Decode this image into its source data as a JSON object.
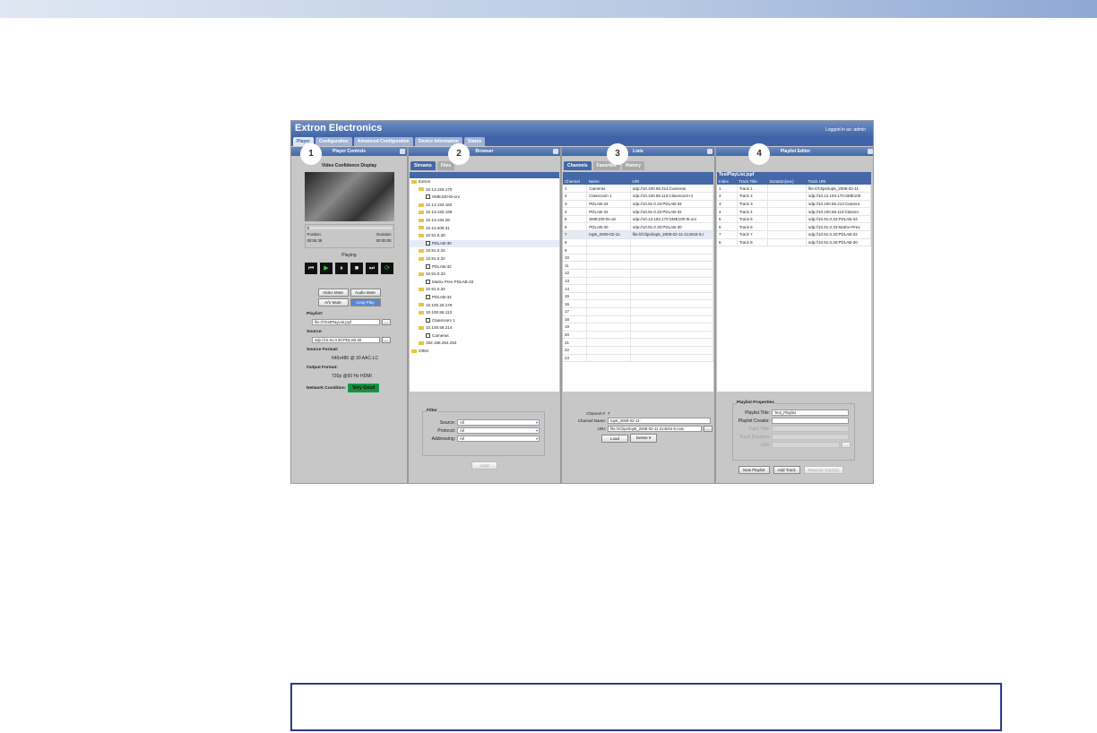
{
  "app": {
    "title": "Extron Electronics",
    "login": "Logged in as: admin"
  },
  "tabs": [
    "Player",
    "Configuration",
    "Advanced Configuration",
    "Device Information",
    "Status"
  ],
  "callouts": [
    "1",
    "2",
    "3",
    "4"
  ],
  "player": {
    "title": "Player Controls",
    "video_title": "Video Confidence Display",
    "position_label": "Position",
    "duration_label": "Duration",
    "position": "00:06:39",
    "duration": "00:00:08",
    "state": "Playing",
    "progress": 0.03,
    "buttons": [
      "Video Mute",
      "Audio Mute",
      "A/V Mute",
      "Loop Play"
    ],
    "playlist_label": "Playlist:",
    "playlist_value": "file:///TestPlayList.jspf",
    "source_label": "Source:",
    "source_value": "sdp://10.91.0.30:PDLAB-30",
    "browse": "...",
    "source_format_label": "Source Format:",
    "source_format": "640x480 @ 30 AAC-LC",
    "output_format_label": "Output Format:",
    "output_format": "720p @60 Hz HDMI",
    "network_label": "Network Condition:",
    "network_value": "Very Good",
    "network_color": "#1f8a3c"
  },
  "browser": {
    "title": "Browser",
    "tabs": [
      "Streams",
      "Files"
    ],
    "tree": [
      {
        "t": "Extron",
        "k": "f",
        "d": 0
      },
      {
        "t": "10.13.193.170",
        "k": "f",
        "d": 1
      },
      {
        "t": "SME100-t5-uni",
        "k": "s",
        "d": 2
      },
      {
        "t": "10.13.193.182",
        "k": "f",
        "d": 1
      },
      {
        "t": "10.13.193.198",
        "k": "f",
        "d": 1
      },
      {
        "t": "10.13.194.28",
        "k": "f",
        "d": 1
      },
      {
        "t": "10.13.209.31",
        "k": "f",
        "d": 1
      },
      {
        "t": "10.91.0.30",
        "k": "f",
        "d": 1
      },
      {
        "t": "PDLAB-30",
        "k": "s",
        "d": 2,
        "sel": true
      },
      {
        "t": "10.91.0.31",
        "k": "f",
        "d": 1
      },
      {
        "t": "10.91.0.32",
        "k": "f",
        "d": 1
      },
      {
        "t": "PDLAB-32",
        "k": "s",
        "d": 2
      },
      {
        "t": "10.91.0.33",
        "k": "f",
        "d": 1
      },
      {
        "t": "Matrix Prev PDLAB-33",
        "k": "s",
        "d": 2
      },
      {
        "t": "10.91.0.34",
        "k": "f",
        "d": 1
      },
      {
        "t": "PDLAB-34",
        "k": "s",
        "d": 2
      },
      {
        "t": "10.100.20.178",
        "k": "f",
        "d": 1
      },
      {
        "t": "10.100.56.113",
        "k": "f",
        "d": 1
      },
      {
        "t": "Classroom 1",
        "k": "s",
        "d": 2
      },
      {
        "t": "10.100.56.214",
        "k": "f",
        "d": 1
      },
      {
        "t": "Cameras",
        "k": "s",
        "d": 2
      },
      {
        "t": "192.168.254.254",
        "k": "f",
        "d": 1
      },
      {
        "t": "Other",
        "k": "f",
        "d": 0
      }
    ],
    "filter": {
      "legend": "Filter",
      "fields": [
        {
          "label": "Source:",
          "value": "All"
        },
        {
          "label": "Protocol:",
          "value": "All"
        },
        {
          "label": "Addressing:",
          "value": "All"
        }
      ],
      "load": "Load"
    }
  },
  "lists": {
    "title": "Lists",
    "tabs": [
      "Channels",
      "Favorites",
      "History"
    ],
    "columns": [
      "Channel",
      "Name",
      "URI"
    ],
    "rows": [
      [
        "1",
        "Cameras",
        "sdp://10.100.56.214:Cameras"
      ],
      [
        "2",
        "Classroom 1",
        "sdp://10.100.56.113:Classroom+1"
      ],
      [
        "3",
        "PDLAB-34",
        "sdp://10.91.0.34:PDLAB-34"
      ],
      [
        "4",
        "PDLAB-32",
        "sdp://10.91.0.32:PDLAB-32"
      ],
      [
        "5",
        "SME100-t5-uni",
        "sdp://10.13.193.170:SME100-t5-uni"
      ],
      [
        "6",
        "PDLAB-30",
        "sdp://10.91.0.30:PDLAB-30"
      ],
      [
        "7",
        "top5_2009-02-11-",
        "file:///Clips/top5_2009-02-11-214044-0.r"
      ],
      [
        "8",
        "",
        ""
      ],
      [
        "9",
        "",
        ""
      ],
      [
        "10",
        "",
        ""
      ],
      [
        "11",
        "",
        ""
      ],
      [
        "12",
        "",
        ""
      ],
      [
        "13",
        "",
        ""
      ],
      [
        "14",
        "",
        ""
      ],
      [
        "15",
        "",
        ""
      ],
      [
        "16",
        "",
        ""
      ],
      [
        "17",
        "",
        ""
      ],
      [
        "18",
        "",
        ""
      ],
      [
        "19",
        "",
        ""
      ],
      [
        "20",
        "",
        ""
      ],
      [
        "21",
        "",
        ""
      ],
      [
        "22",
        "",
        ""
      ],
      [
        "23",
        "",
        ""
      ]
    ],
    "detail": {
      "channel_label": "Channel #:",
      "channel": "7",
      "name_label": "Channel Name:",
      "name": "top5_2009-02-11-",
      "uri_label": "URI:",
      "uri": "file:///Clips/top5_2009-02-11-214044-0.m4v",
      "load": "Load",
      "delete": "Delete"
    }
  },
  "playlist": {
    "title": "Playlist Editor",
    "file": "TestPlayList.jspf",
    "columns": [
      "Index",
      "Track Title",
      "Duration(sec)",
      "Track URI"
    ],
    "rows": [
      [
        "1",
        "Track 1",
        "",
        "file:///Clips/top5_2009-02-11-"
      ],
      [
        "2",
        "Track 2",
        "",
        "sdp://10.13.193.170:SME100"
      ],
      [
        "3",
        "Track 3",
        "",
        "sdp://10.100.56.214:Camera"
      ],
      [
        "4",
        "Track 4",
        "",
        "sdp://10.100.56.113:Classro"
      ],
      [
        "5",
        "Track 5",
        "",
        "sdp://10.91.0.34:PDLAB-34"
      ],
      [
        "6",
        "Track 6",
        "",
        "sdp://10.91.0.33:Matrix+Prev"
      ],
      [
        "7",
        "Track 7",
        "",
        "sdp://10.91.0.32:PDLAB-32"
      ],
      [
        "8",
        "Track 8",
        "",
        "sdp://10.91.0.30:PDLAB-30"
      ]
    ],
    "props": {
      "legend": "Playlist Properties",
      "title_label": "Playlist Title:",
      "title": "Test_Playlist",
      "creator_label": "Playlist Creator:",
      "track_title_label": "Track Title:",
      "track_duration_label": "Track Duration:",
      "uri_label": "URI:"
    },
    "buttons": [
      "New Playlist",
      "Add Track",
      "Remove Track(s)"
    ]
  }
}
